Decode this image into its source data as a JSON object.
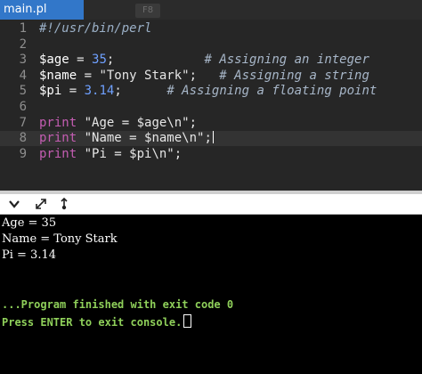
{
  "tabs": {
    "active": "main.pl",
    "ghost": "F8"
  },
  "editor": {
    "lines": [
      {
        "n": "1",
        "segments": [
          [
            "shebang",
            "#!/usr/bin/perl"
          ]
        ]
      },
      {
        "n": "2",
        "segments": []
      },
      {
        "n": "3",
        "segments": [
          [
            "var",
            "$age"
          ],
          [
            "str",
            " = "
          ],
          [
            "num",
            "35"
          ],
          [
            "str",
            ";"
          ],
          [
            "cmt",
            "            # Assigning an integer"
          ]
        ]
      },
      {
        "n": "4",
        "segments": [
          [
            "var",
            "$name"
          ],
          [
            "str",
            " = \"Tony Stark\";"
          ],
          [
            "cmt",
            "   # Assigning a string"
          ]
        ]
      },
      {
        "n": "5",
        "segments": [
          [
            "var",
            "$pi"
          ],
          [
            "str",
            " = "
          ],
          [
            "num",
            "3.14"
          ],
          [
            "str",
            ";"
          ],
          [
            "cmt",
            "      # Assigning a floating point"
          ]
        ]
      },
      {
        "n": "6",
        "segments": []
      },
      {
        "n": "7",
        "segments": [
          [
            "kw",
            "print"
          ],
          [
            "str",
            " \"Age = $age\\n\";"
          ]
        ]
      },
      {
        "n": "8",
        "segments": [
          [
            "kw",
            "print"
          ],
          [
            "str",
            " \"Name = $name\\n\";"
          ]
        ]
      },
      {
        "n": "9",
        "segments": [
          [
            "kw",
            "print"
          ],
          [
            "str",
            " \"Pi = $pi\\n\";"
          ]
        ]
      }
    ],
    "active_line": 8
  },
  "console": {
    "toolbar_icons": [
      "chevron-down-icon",
      "expand-icon",
      "share-icon"
    ],
    "output": [
      "Age = 35",
      "Name = Tony Stark",
      "Pi = 3.14"
    ],
    "status": [
      "...Program finished with exit code 0",
      "Press ENTER to exit console."
    ]
  },
  "colors": {
    "tab_active": "#3277c9",
    "editor_bg": "#262626",
    "keyword": "#c45db2",
    "number": "#6fa0ff",
    "status_green": "#8fd05a"
  }
}
